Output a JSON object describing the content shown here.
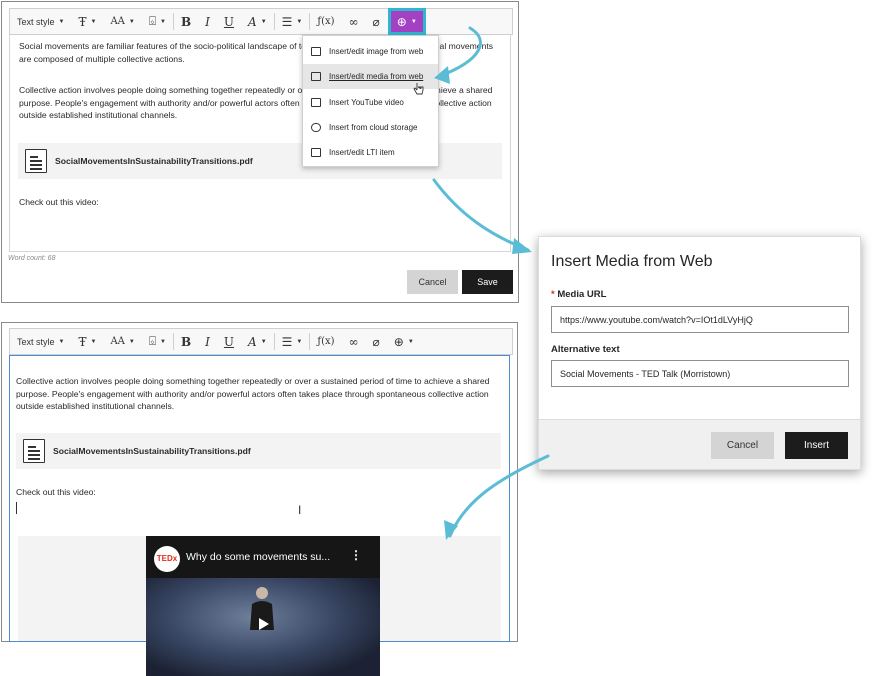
{
  "toolbar": {
    "text_style": "Text style",
    "buttons": [
      "font-format-icon",
      "text-size-icon",
      "text-color-icon",
      "bold-icon",
      "italic-icon",
      "underline-icon",
      "clear-format-icon",
      "list-icon",
      "math-icon",
      "link-icon",
      "attach-icon",
      "insert-content-icon"
    ]
  },
  "editor_top": {
    "para1": "Social movements are familiar features of the socio-political landscape of today's world. Broadly speaking, social movements are composed of multiple collective actions.",
    "para2": "Collective action involves people doing something together repeatedly or over a sustained period of time to achieve a shared purpose. People's engagement with authority and/or powerful actors often takes place through spontaneous collective action outside established institutional channels.",
    "file_name": "SocialMovementsInSustainabilityTransitions.pdf",
    "check_text": "Check out this video:",
    "word_count": "Word count: 68",
    "cancel": "Cancel",
    "save": "Save"
  },
  "dropdown": {
    "items": [
      {
        "label": "Insert/edit image from web",
        "icon": "image-icon"
      },
      {
        "label": "Insert/edit media from web",
        "icon": "media-icon",
        "hover": true
      },
      {
        "label": "Insert YouTube video",
        "icon": "youtube-icon"
      },
      {
        "label": "Insert from cloud storage",
        "icon": "cloud-icon"
      },
      {
        "label": "Insert/edit LTI item",
        "icon": "lti-icon"
      }
    ]
  },
  "dialog": {
    "title": "Insert Media from Web",
    "url_label": "Media URL",
    "required_mark": "*",
    "url_value": "https://www.youtube.com/watch?v=IOt1dLVyHjQ",
    "alt_label": "Alternative text",
    "alt_value": "Social Movements - TED Talk (Morristown)",
    "cancel": "Cancel",
    "insert": "Insert"
  },
  "editor_bottom": {
    "para": "Collective action involves people doing something together repeatedly or over a sustained period of time to achieve a shared purpose. People's engagement with authority and/or powerful actors often takes place through spontaneous collective action outside established institutional channels.",
    "file_name": "SocialMovementsInSustainabilityTransitions.pdf",
    "check_text": "Check out this video:",
    "video_title": "Why do some movements su...",
    "ted_badge": "TEDx"
  },
  "colors": {
    "insert_button_active": "#a341c3",
    "highlight_outline": "#2fb7cf",
    "arrow": "#5bbcd6",
    "required": "#c0392b"
  }
}
